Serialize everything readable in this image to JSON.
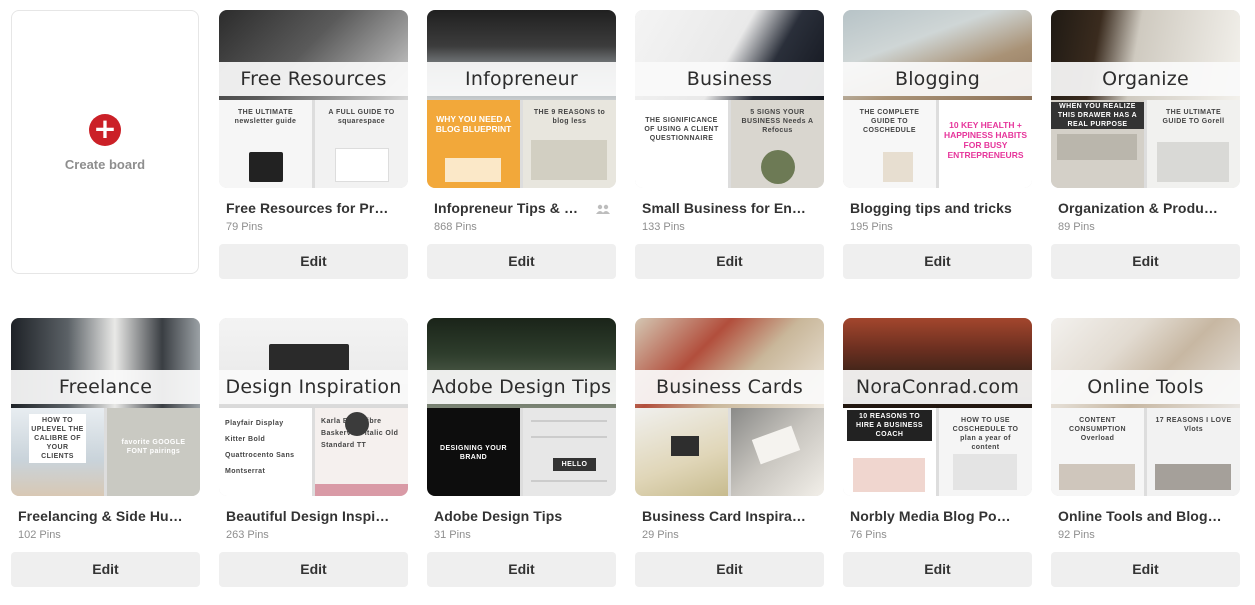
{
  "create_board": {
    "label": "Create board",
    "icon": "plus-icon"
  },
  "accent_color": "#cb2027",
  "boards": [
    {
      "banner": "Free Resources",
      "title": "Free Resources for Pr…",
      "pins": "79 Pins",
      "edit": "Edit",
      "left_text": "THE ULTIMATE newsletter guide",
      "right_text": "A FULL GUIDE TO squarespace"
    },
    {
      "banner": "Infopreneur",
      "title": "Infopreneur Tips & …",
      "pins": "868 Pins",
      "edit": "Edit",
      "group_icon": "group-icon",
      "left_text": "WHY YOU NEED A BLOG BLUEPRINT",
      "right_text": "THE 9 REASONS to blog less"
    },
    {
      "banner": "Business",
      "title": "Small Business for En…",
      "pins": "133 Pins",
      "edit": "Edit",
      "left_text": "THE SIGNIFICANCE OF USING A CLIENT QUESTIONNAIRE",
      "right_text": "5 SIGNS YOUR BUSINESS Needs A Refocus"
    },
    {
      "banner": "Blogging",
      "title": "Blogging tips and tricks",
      "pins": "195 Pins",
      "edit": "Edit",
      "left_text": "THE COMPLETE GUIDE TO COSCHEDULE",
      "right_text": "10 KEY HEALTH + HAPPINESS HABITS FOR BUSY ENTREPRENEURS"
    },
    {
      "banner": "Organize",
      "title": "Organization & Produ…",
      "pins": "89 Pins",
      "edit": "Edit",
      "left_text": "WHEN YOU REALIZE THIS DRAWER HAS A REAL PURPOSE",
      "right_text": "THE ULTIMATE GUIDE TO Gorell"
    },
    {
      "banner": "Freelance",
      "title": "Freelancing & Side Hu…",
      "pins": "102 Pins",
      "edit": "Edit",
      "left_text": "HOW TO UPLEVEL THE CALIBRE OF YOUR CLIENTS",
      "right_text": "favorite GOOGLE FONT pairings"
    },
    {
      "banner": "Design Inspiration",
      "title": "Beautiful Design Inspi…",
      "pins": "263 Pins",
      "edit": "Edit",
      "left_text": "Playfair Display Kitter Bold Quattrocento Sans Montserrat",
      "right_text": "Karla Bold Libre Baskerville Italic Old Standard TT"
    },
    {
      "banner": "Adobe Design Tips",
      "title": "Adobe Design Tips",
      "pins": "31 Pins",
      "edit": "Edit",
      "left_text": "DESIGNING YOUR BRAND",
      "right_text": "HELLO"
    },
    {
      "banner": "Business Cards",
      "title": "Business Card Inspira…",
      "pins": "29 Pins",
      "edit": "Edit",
      "left_text": "",
      "right_text": ""
    },
    {
      "banner": "NoraConrad.com",
      "title": "Norbly Media Blog Po…",
      "pins": "76 Pins",
      "edit": "Edit",
      "left_text": "10 REASONS TO HIRE A BUSINESS COACH",
      "right_text": "HOW TO USE COSCHEDULE TO plan a year of content"
    },
    {
      "banner": "Online Tools",
      "title": "Online Tools and Blog…",
      "pins": "92 Pins",
      "edit": "Edit",
      "left_text": "CONTENT CONSUMPTION Overload",
      "right_text": "17 REASONS I LOVE Vlots"
    }
  ]
}
